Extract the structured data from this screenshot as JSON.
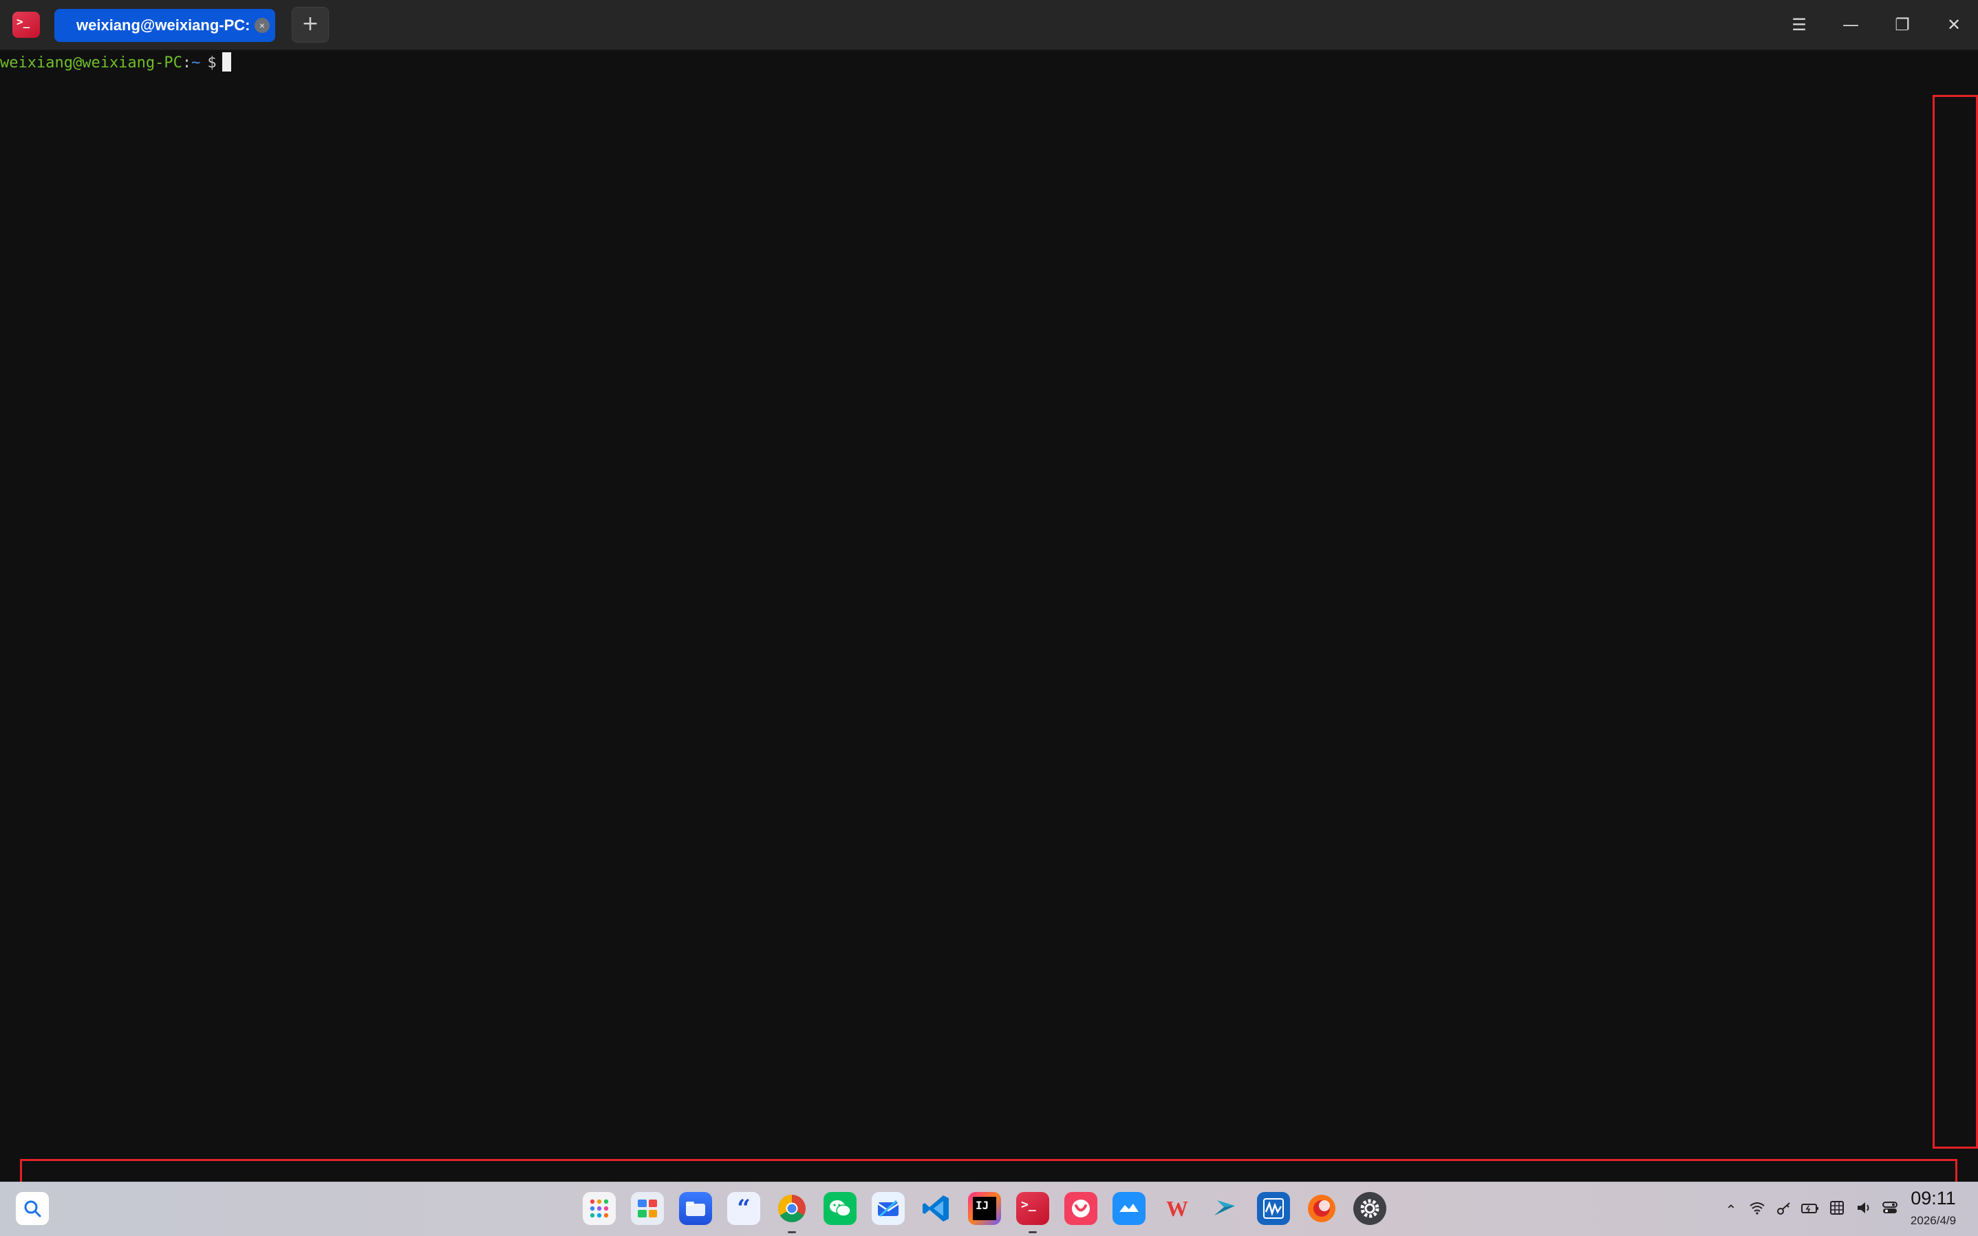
{
  "window": {
    "tab_title": "weixiang@weixiang-PC: ~",
    "tab_close_glyph": "×",
    "new_tab_glyph": "+",
    "menu_glyph": "☰",
    "minimize_glyph": "—",
    "restore_glyph": "❐",
    "close_glyph": "✕",
    "app_icon_glyph": ">_"
  },
  "terminal": {
    "prompt_user_host": "weixiang@weixiang-PC",
    "prompt_separator": ":",
    "prompt_path": "~",
    "prompt_symbol": "$"
  },
  "taskbar": {
    "apps": [
      {
        "name": "launcher",
        "icon": "grid-icon"
      },
      {
        "name": "multitask",
        "icon": "multitask-icon"
      },
      {
        "name": "file-manager",
        "icon": "folder-icon"
      },
      {
        "name": "quote-app",
        "icon": "quote-icon"
      },
      {
        "name": "chrome",
        "icon": "chrome-icon"
      },
      {
        "name": "wechat",
        "icon": "wechat-icon"
      },
      {
        "name": "mail",
        "icon": "mail-icon"
      },
      {
        "name": "vscode",
        "icon": "vscode-icon"
      },
      {
        "name": "jetbrains",
        "icon": "jetbrains-icon"
      },
      {
        "name": "terminal",
        "icon": "terminal-icon"
      },
      {
        "name": "app-store",
        "icon": "app-store-icon"
      },
      {
        "name": "lanxin",
        "icon": "cloud-icon"
      },
      {
        "name": "wps",
        "icon": "wps-icon"
      },
      {
        "name": "arrow-app",
        "icon": "arrow-icon"
      },
      {
        "name": "system-monitor",
        "icon": "monitor-icon"
      },
      {
        "name": "browser",
        "icon": "browser-icon"
      },
      {
        "name": "settings",
        "icon": "settings-icon"
      }
    ],
    "clock_time": "09:11",
    "clock_date": "2026/4/9"
  }
}
